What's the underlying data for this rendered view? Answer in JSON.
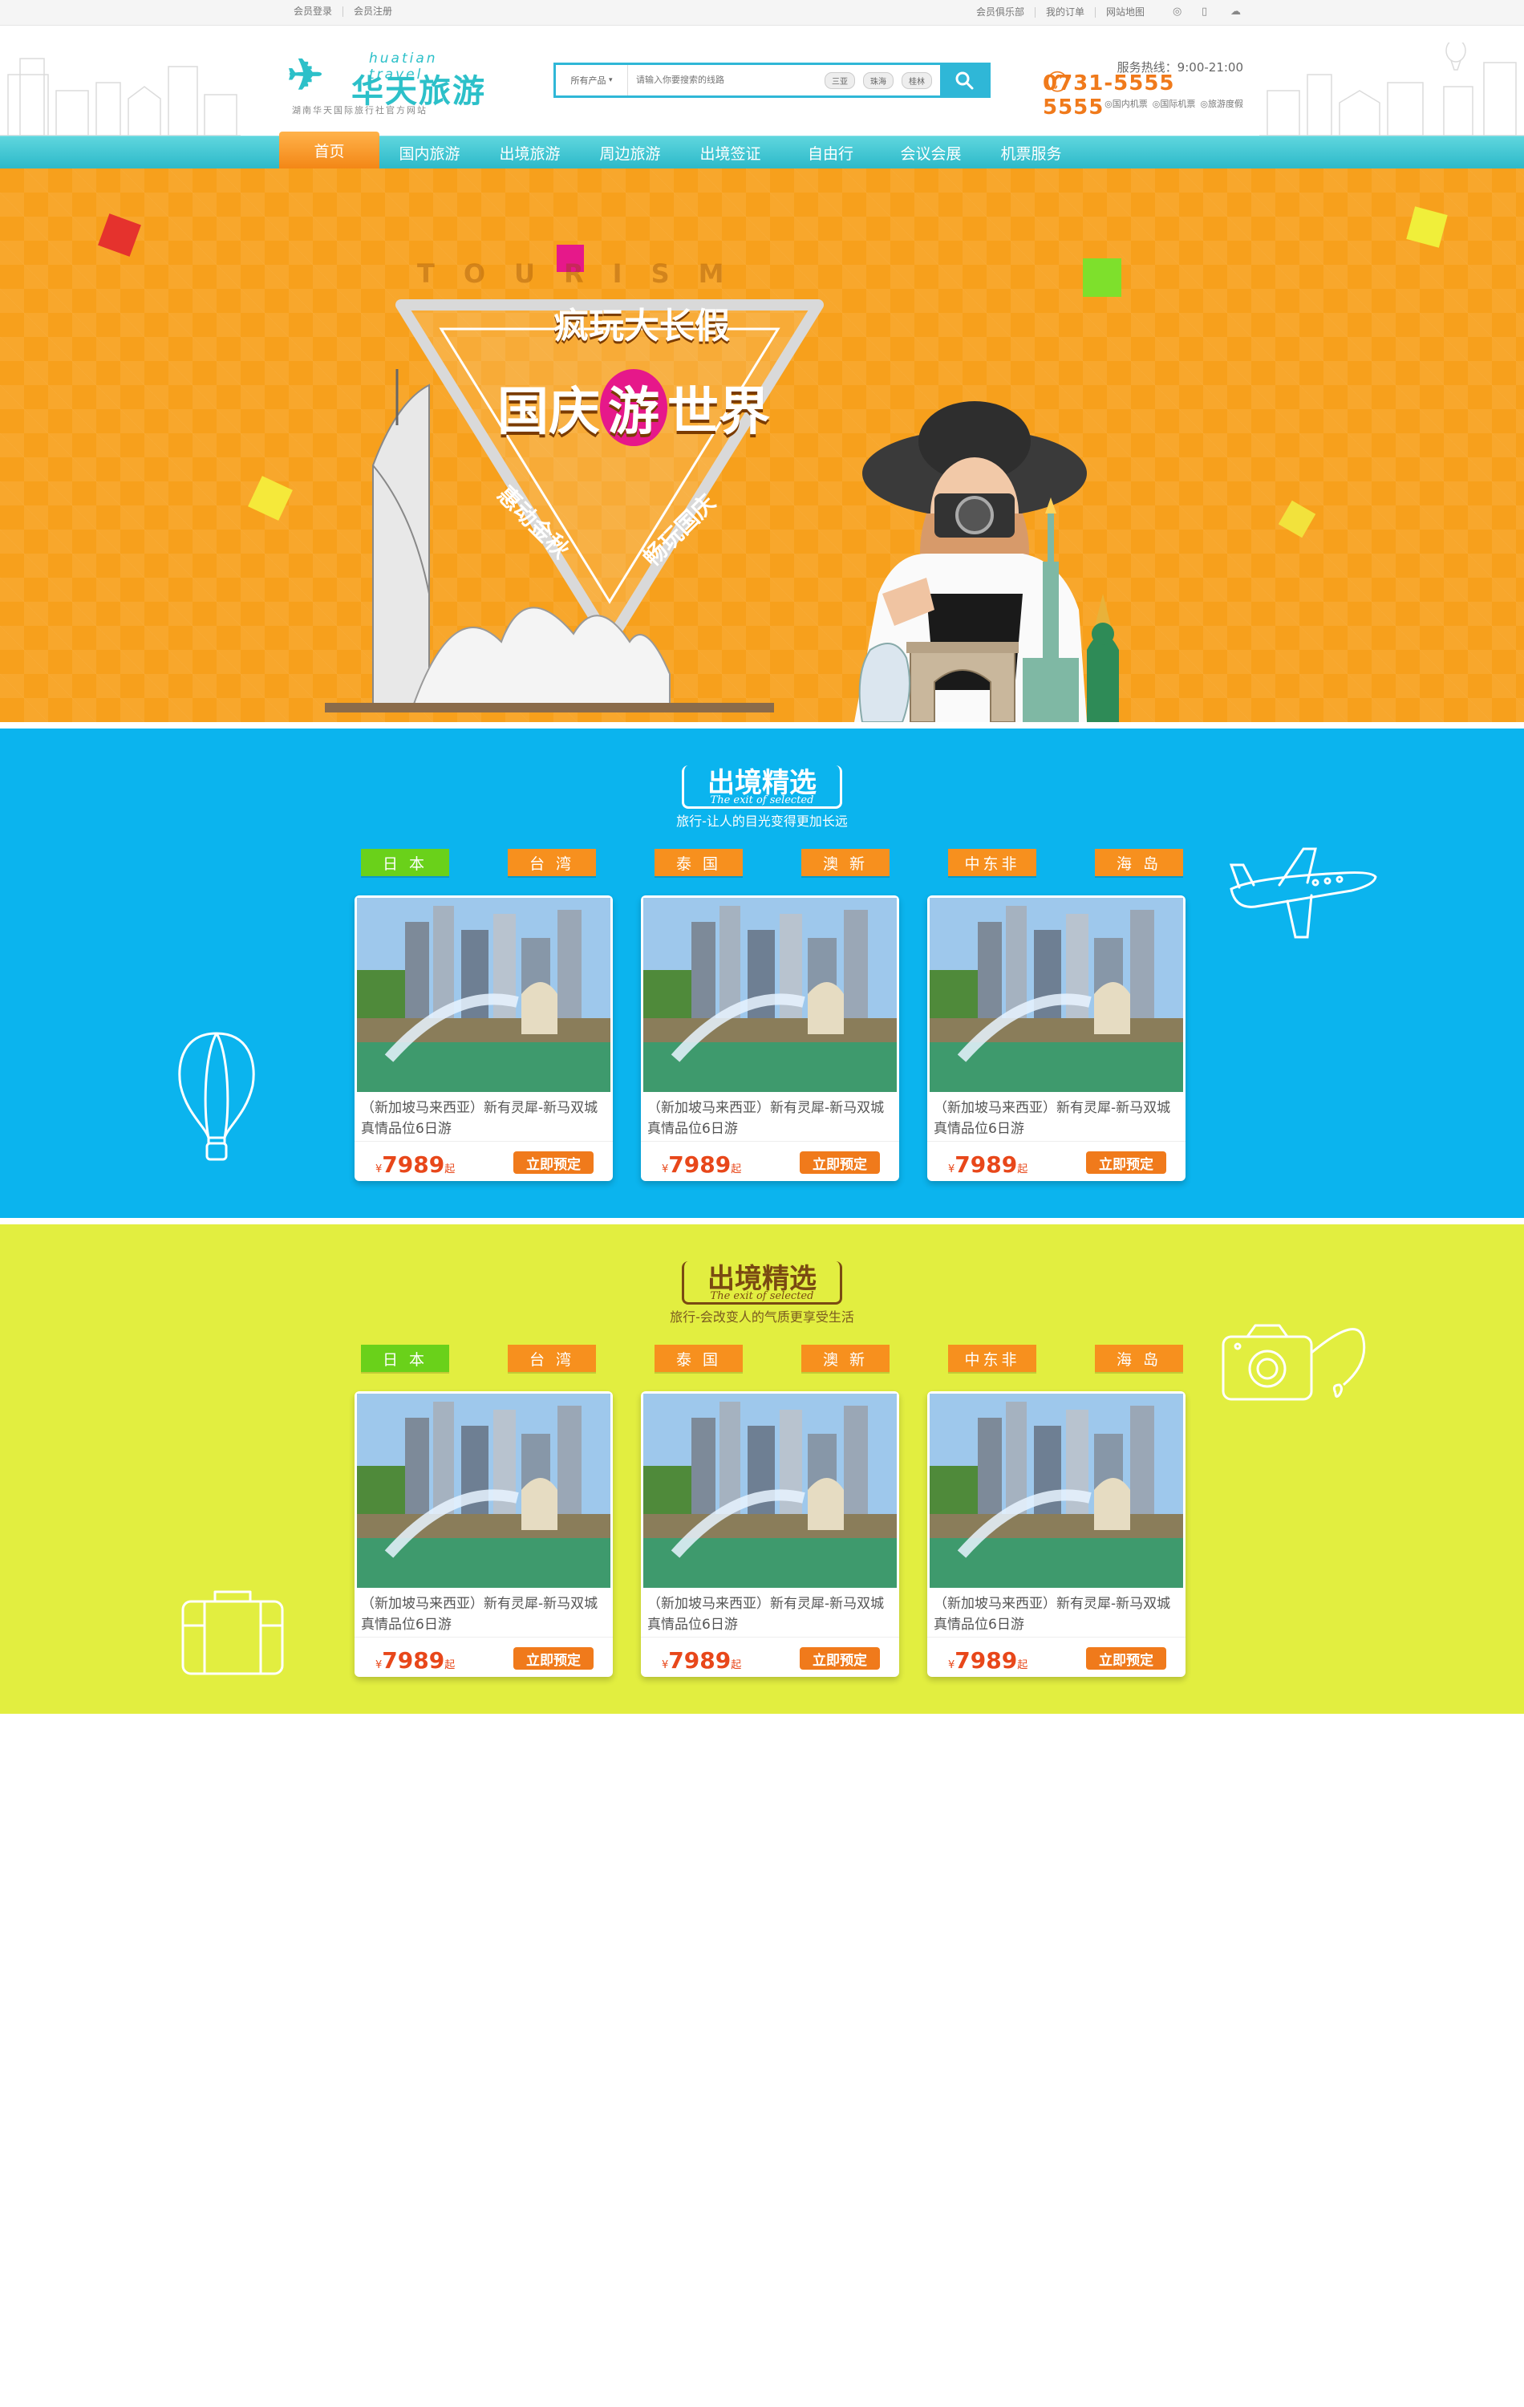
{
  "topbar": {
    "left": [
      "会员登录",
      "会员注册"
    ],
    "right": [
      "会员俱乐部",
      "我的订单",
      "网站地图"
    ]
  },
  "logo": {
    "cn": "华天旅游",
    "en": "huatian travel",
    "sub": "湖南华天国际旅行社官方网站"
  },
  "search": {
    "category": "所有产品",
    "placeholder": "请输入你要搜索的线路",
    "tags": [
      "三亚",
      "珠海",
      "桂林"
    ]
  },
  "hotline": {
    "label": "服务热线：9:00-21:00",
    "number": "0731-5555 5555",
    "links": [
      "◎国内机票",
      "◎国际机票",
      "◎旅游度假"
    ]
  },
  "nav": [
    "首页",
    "国内旅游",
    "出境旅游",
    "周边旅游",
    "出境签证",
    "自由行",
    "会议会展",
    "机票服务"
  ],
  "banner": {
    "tourism": "TOURISM",
    "line1": "疯玩大长假",
    "line2_a": "国庆",
    "line2_b": "游",
    "line2_c": "世界",
    "left_diag": "惠动金秋",
    "right_diag": "畅玩国庆"
  },
  "sections": [
    {
      "title": "出境精选",
      "title_en": "The exit of selected",
      "subtitle": "旅行-让人的目光变得更加长远",
      "title_color": "#ffffff",
      "sub_color": "#ffffff",
      "tabs": [
        "日 本",
        "台 湾",
        "泰 国",
        "澳 新",
        "中东非",
        "海 岛"
      ],
      "cards": [
        {
          "title": "（新加坡马来西亚）新有灵犀-新马双城真情品位6日游",
          "currency": "¥",
          "price": "7989",
          "suffix": "起",
          "button": "立即预定"
        },
        {
          "title": "（新加坡马来西亚）新有灵犀-新马双城真情品位6日游",
          "currency": "¥",
          "price": "7989",
          "suffix": "起",
          "button": "立即预定"
        },
        {
          "title": "（新加坡马来西亚）新有灵犀-新马双城真情品位6日游",
          "currency": "¥",
          "price": "7989",
          "suffix": "起",
          "button": "立即预定"
        }
      ]
    },
    {
      "title": "出境精选",
      "title_en": "The exit of selected",
      "subtitle": "旅行-会改变人的气质更享受生活",
      "title_color": "#7a4a12",
      "sub_color": "#7a5a20",
      "tabs": [
        "日 本",
        "台 湾",
        "泰 国",
        "澳 新",
        "中东非",
        "海 岛"
      ],
      "cards": [
        {
          "title": "（新加坡马来西亚）新有灵犀-新马双城真情品位6日游",
          "currency": "¥",
          "price": "7989",
          "suffix": "起",
          "button": "立即预定"
        },
        {
          "title": "（新加坡马来西亚）新有灵犀-新马双城真情品位6日游",
          "currency": "¥",
          "price": "7989",
          "suffix": "起",
          "button": "立即预定"
        },
        {
          "title": "（新加坡马来西亚）新有灵犀-新马双城真情品位6日游",
          "currency": "¥",
          "price": "7989",
          "suffix": "起",
          "button": "立即预定"
        }
      ]
    }
  ],
  "colors": {
    "teal": "#2cc0c9",
    "orange": "#f7901e",
    "blue_section": "#0bb4ee",
    "lime_section": "#e2ee40"
  }
}
